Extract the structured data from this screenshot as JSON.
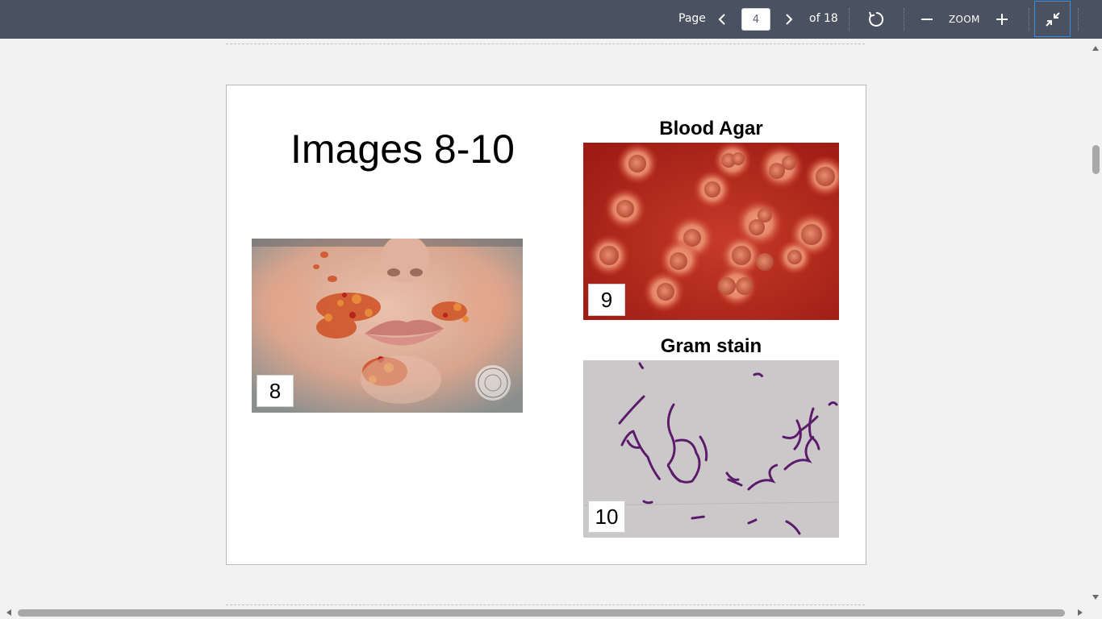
{
  "toolbar": {
    "page_label": "Page",
    "page_value": "4",
    "of_label": "of 18",
    "zoom_label": "ZOOM",
    "icons": [
      "chevron-left-icon",
      "chevron-right-icon",
      "rotate-icon",
      "minus-icon",
      "plus-icon",
      "exit-fullscreen-icon"
    ]
  },
  "slide": {
    "title": "Images 8-10",
    "captions": {
      "blood_agar": "Blood Agar",
      "gram_stain": "Gram stain"
    },
    "numbers": {
      "img8": "8",
      "img9": "9",
      "img10": "10"
    }
  },
  "colors": {
    "toolbar_bg": "#4a5160",
    "agar_red": "#b8271c",
    "gram_bg": "#c9c6c8",
    "bacteria": "#5c1a6b",
    "focus_border": "#3b8fe0"
  }
}
